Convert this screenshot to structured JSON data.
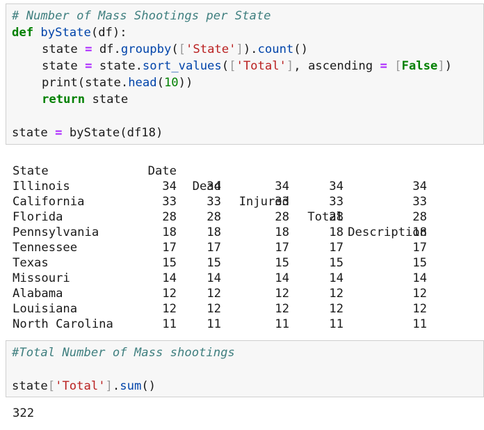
{
  "cell1": {
    "comment": "# Number of Mass Shootings per State",
    "def_kw": "def",
    "fn_name": "byState",
    "fn_params": "(df):",
    "l2_a": "state",
    "l2_eq": "=",
    "l2_b": "df.",
    "l2_groupby": "groupby",
    "l2_c": "(",
    "l2_br1": "[",
    "l2_str": "'State'",
    "l2_br2": "]",
    "l2_d": ").",
    "l2_count": "count",
    "l2_e": "()",
    "l3_a": "state",
    "l3_eq": "=",
    "l3_b": "state.",
    "l3_sort": "sort_values",
    "l3_c": "(",
    "l3_br1": "[",
    "l3_str": "'Total'",
    "l3_br2": "]",
    "l3_d": ", ascending",
    "l3_eq2": "=",
    "l3_br3": "[",
    "l3_false": "False",
    "l3_br4": "]",
    "l3_e": ")",
    "l4_print": "print",
    "l4_a": "(state.",
    "l4_head": "head",
    "l4_b": "(",
    "l4_num": "10",
    "l4_c": "))",
    "l5_return": "return",
    "l5_a": " state",
    "l7_a": "state",
    "l7_eq": "=",
    "l7_b": "byState(df18)"
  },
  "output1": {
    "columns": [
      "Date",
      "Dead",
      "Injured",
      "Total",
      "Description"
    ],
    "index_name": "State",
    "rows": [
      {
        "state": "Illinois",
        "values": [
          "34",
          "34",
          "34",
          "34",
          "34"
        ]
      },
      {
        "state": "California",
        "values": [
          "33",
          "33",
          "33",
          "33",
          "33"
        ]
      },
      {
        "state": "Florida",
        "values": [
          "28",
          "28",
          "28",
          "28",
          "28"
        ]
      },
      {
        "state": "Pennsylvania",
        "values": [
          "18",
          "18",
          "18",
          "18",
          "18"
        ]
      },
      {
        "state": "Tennessee",
        "values": [
          "17",
          "17",
          "17",
          "17",
          "17"
        ]
      },
      {
        "state": "Texas",
        "values": [
          "15",
          "15",
          "15",
          "15",
          "15"
        ]
      },
      {
        "state": "Missouri",
        "values": [
          "14",
          "14",
          "14",
          "14",
          "14"
        ]
      },
      {
        "state": "Alabama",
        "values": [
          "12",
          "12",
          "12",
          "12",
          "12"
        ]
      },
      {
        "state": "Louisiana",
        "values": [
          "12",
          "12",
          "12",
          "12",
          "12"
        ]
      },
      {
        "state": "North Carolina",
        "values": [
          "11",
          "11",
          "11",
          "11",
          "11"
        ]
      }
    ]
  },
  "cell2": {
    "comment": "#Total Number of Mass shootings",
    "l3_a": "state",
    "l3_br1": "[",
    "l3_str": "'Total'",
    "l3_br2": "]",
    "l3_b": ".",
    "l3_sum": "sum",
    "l3_c": "()"
  },
  "output2": {
    "value": "322"
  }
}
